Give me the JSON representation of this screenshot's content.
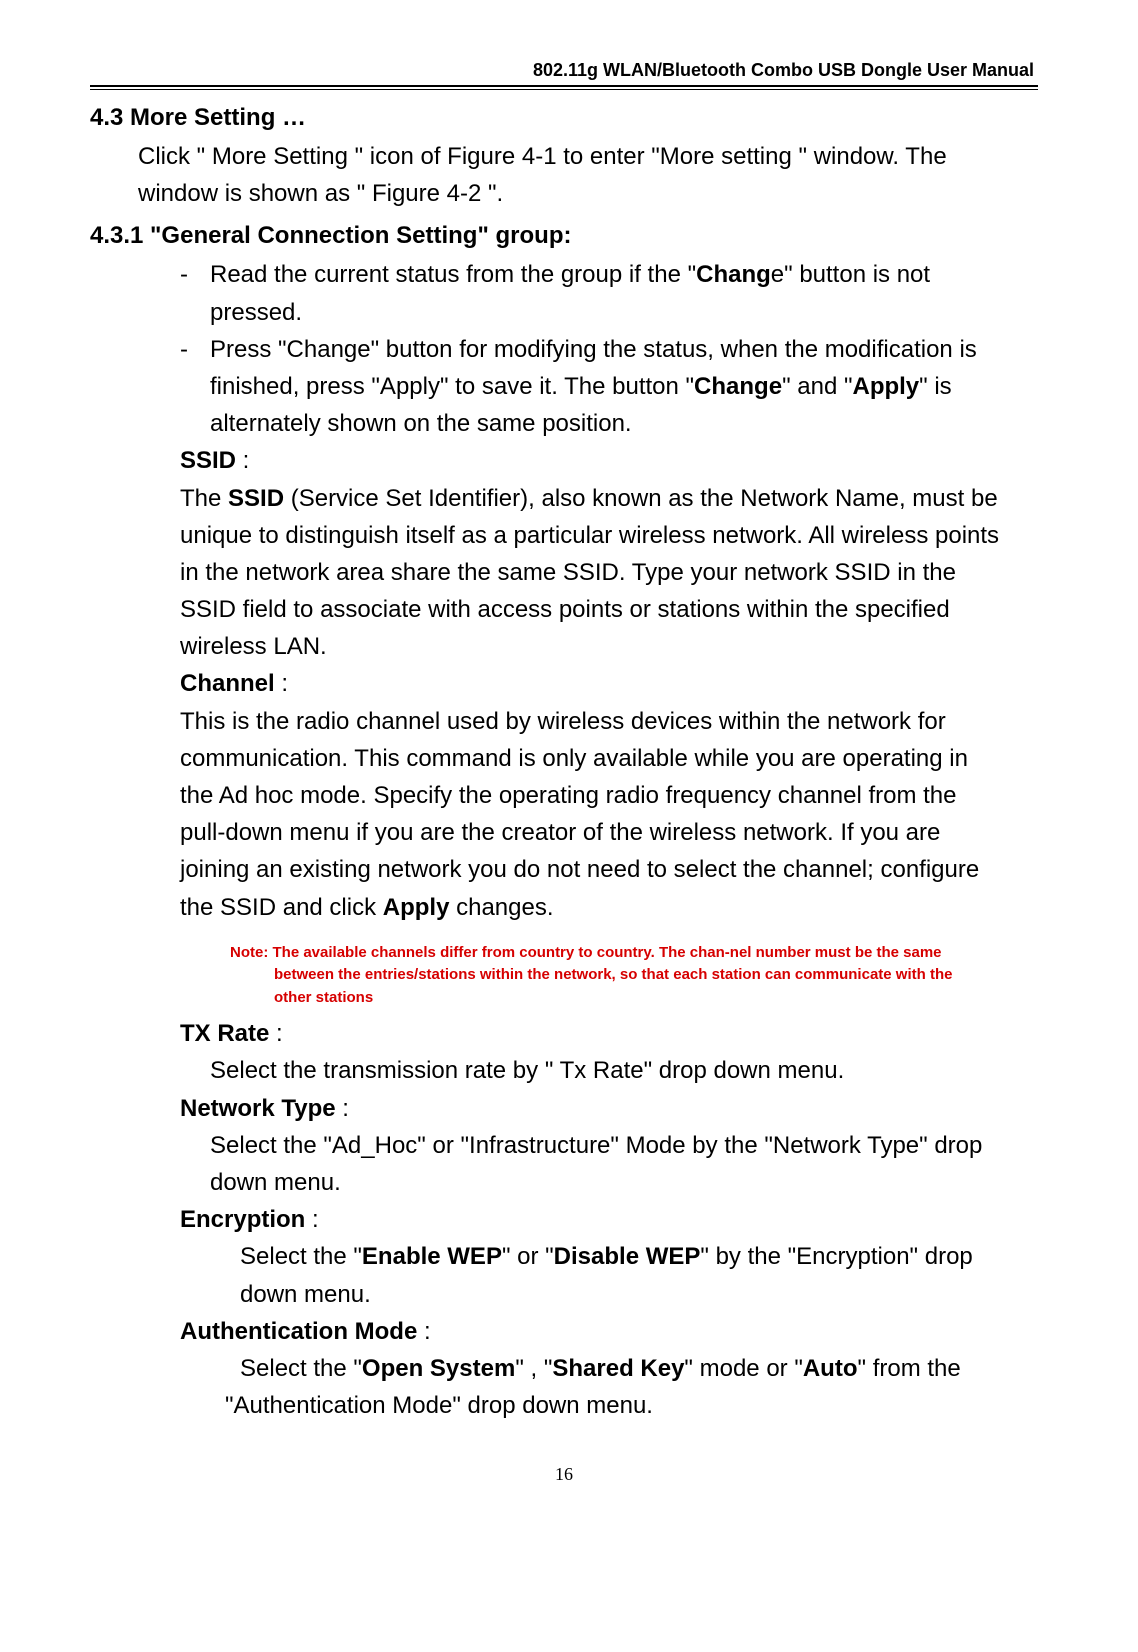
{
  "running_head": "802.11g  WLAN/Bluetooth  Combo  USB  Dongle  User  Manual",
  "s43": {
    "head": "4.3 More Setting …",
    "intro1": "Click \" More Setting \" icon of Figure 4-1 to enter \"More setting \" window. The",
    "intro2": "window is shown as \" Figure 4-2 \"."
  },
  "s431": {
    "head": "4.3.1 \"General Connection Setting\" group:",
    "b1a": "Read the current status from the group if the \"",
    "b1_bold": "Chang",
    "b1b": "e\" button is not",
    "b1c": "pressed.",
    "b2a": "Press \"Change\" button for modifying the status, when the modification is",
    "b2b_pre": "finished, press \"Apply\" to save it. The button \"",
    "b2b_bold1": "Change",
    "b2b_mid": "\" and \"",
    "b2b_bold2": "Apply",
    "b2b_post": "\" is",
    "b2c": "alternately shown on the same position."
  },
  "ssid": {
    "head": "SSID",
    "colon": " :",
    "l1a": "The ",
    "l1_bold": "SSID",
    "l1b": " (Service Set Identifier), also known as the Network Name, must be",
    "l2": "unique to distinguish itself as a particular wireless network. All wireless points",
    "l3": "in the network area share the same SSID. Type your network SSID in the",
    "l4": "SSID field to associate with access points or stations within the specified",
    "l5": "wireless LAN."
  },
  "channel": {
    "head": "Channel",
    "colon": " :",
    "l1": "This is the radio channel used by wireless devices within the network for",
    "l2": "communication. This command is only available while you are operating in",
    "l3": "the Ad hoc mode. Specify the operating radio frequency channel from the",
    "l4": "pull-down menu if you are the creator of the wireless network. If you are",
    "l5": "joining an existing network you do not need to select the channel; configure",
    "l6a": "the SSID and click ",
    "l6_bold": "Apply",
    "l6b": " changes."
  },
  "note": {
    "l1": "Note: The available channels differ from country to country. The chan-nel number must be the same",
    "l2": "between the entries/stations within the network, so that each station can communicate with the",
    "l3": "other stations"
  },
  "txrate": {
    "head": "TX Rate",
    "colon": " :",
    "l1": "Select the transmission rate by \" Tx Rate\" drop down menu."
  },
  "nettype": {
    "head": "Network Type",
    "colon": " :",
    "l1": "Select the \"Ad_Hoc\" or \"Infrastructure\" Mode by the \"Network Type\" drop",
    "l2": "down menu."
  },
  "enc": {
    "head": "Encryption",
    "colon": " :",
    "l1a": "Select the \"",
    "l1_bold1": "Enable WEP",
    "l1_mid": "\" or \"",
    "l1_bold2": "Disable WEP",
    "l1b": "\" by the \"Encryption\" drop",
    "l2": "down menu."
  },
  "auth": {
    "head": "Authentication Mode",
    "colon": "    :",
    "l1a": "Select the \"",
    "l1_bold1": "Open System",
    "l1_mid1": "\" , \"",
    "l1_bold2": "Shared Key",
    "l1_mid2": "\" mode or \"",
    "l1_bold3": "Auto",
    "l1b": "\" from the",
    "l2": "\"Authentication Mode\" drop down menu."
  },
  "page_no": "16"
}
